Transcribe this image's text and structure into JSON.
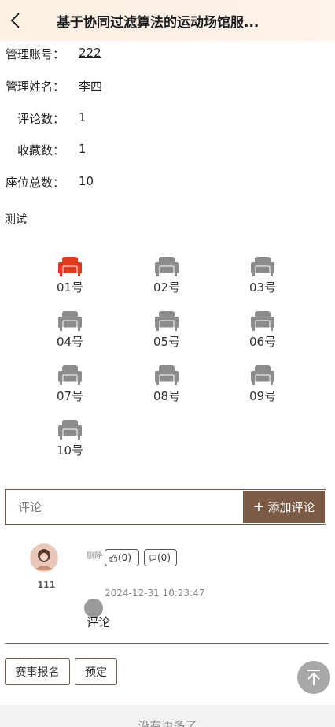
{
  "header": {
    "title": "基于协同过滤算法的运动场馆服..."
  },
  "info": [
    {
      "label": "管理账号：",
      "value": "222"
    },
    {
      "label": "管理姓名：",
      "value": "李四"
    },
    {
      "label": "评论数：",
      "value": "1"
    },
    {
      "label": "收藏数：",
      "value": "1"
    },
    {
      "label": "座位总数：",
      "value": "10"
    }
  ],
  "section_title": "测试",
  "seats": [
    {
      "label": "01号",
      "selected": true
    },
    {
      "label": "02号",
      "selected": false
    },
    {
      "label": "03号",
      "selected": false
    },
    {
      "label": "04号",
      "selected": false
    },
    {
      "label": "05号",
      "selected": false
    },
    {
      "label": "06号",
      "selected": false
    },
    {
      "label": "07号",
      "selected": false
    },
    {
      "label": "08号",
      "selected": false
    },
    {
      "label": "09号",
      "selected": false
    },
    {
      "label": "10号",
      "selected": false
    }
  ],
  "colors": {
    "seat_selected": "#e0391d",
    "seat_default": "#8c8c8c",
    "accent": "#7b5b45"
  },
  "comment_form": {
    "placeholder": "评论",
    "add_label": "添加评论",
    "add_icon": "plus-icon"
  },
  "comment": {
    "username": "111",
    "delete_label": "删除",
    "likes": "(0)",
    "dislikes": "(0)",
    "time": "2024-12-31 10:23:47",
    "text": "评论"
  },
  "actions": {
    "register": "赛事报名",
    "reserve": "预定"
  },
  "footer": {
    "text": "没有更多了"
  }
}
